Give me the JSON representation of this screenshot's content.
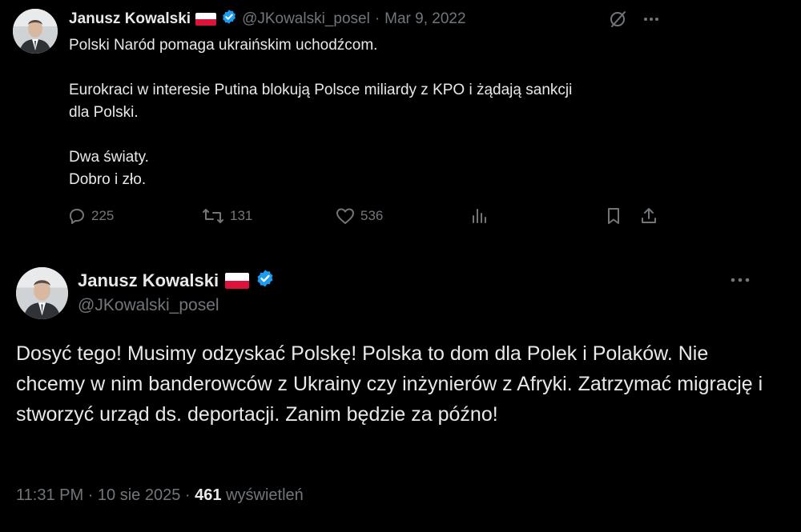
{
  "tweet1": {
    "author_name": "Janusz Kowalski",
    "handle": "@JKowalski_posel",
    "separator": "·",
    "date": "Mar 9, 2022",
    "text": "Polski Naród pomaga ukraińskim uchodźcom.\n\nEurokraci w interesie Putina blokują Polsce miliardy z KPO i żądają sankcji\ndla Polski.\n\nDwa światy.\nDobro i zło.",
    "replies": "225",
    "retweets": "131",
    "likes": "536"
  },
  "tweet2": {
    "author_name": "Janusz Kowalski",
    "handle": "@JKowalski_posel",
    "text": "Dosyć tego! Musimy odzyskać Polskę! Polska to dom dla Polek i Polaków. Nie chcemy w nim banderowców z Ukrainy czy inżynierów z Afryki. Zatrzymać migrację i stworzyć urząd ds. deportacji. Zanim będzie za późno!",
    "time": "11:31 PM",
    "separator": "·",
    "date": "10 sie 2025",
    "views_count": "461",
    "views_label": "wyświetleń"
  },
  "icons": [
    "flag-poland-icon",
    "verified-badge-icon",
    "grok-icon",
    "more-icon",
    "reply-icon",
    "retweet-icon",
    "like-icon",
    "analytics-icon",
    "bookmark-icon",
    "share-icon"
  ],
  "colors": {
    "background": "#000000",
    "text": "#e7e9ea",
    "muted": "#71767b",
    "verified": "#1d9bf0",
    "flag_red": "#dc143c"
  }
}
